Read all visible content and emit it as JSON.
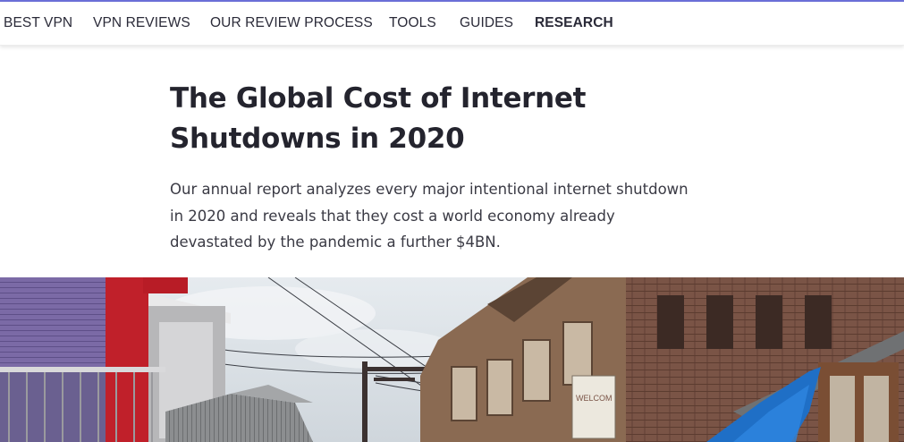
{
  "nav": {
    "items": [
      {
        "label": "BEST VPN",
        "active": false
      },
      {
        "label": "VPN REVIEWS",
        "active": false
      },
      {
        "label": "OUR REVIEW PROCESS",
        "active": false
      },
      {
        "label": "TOOLS",
        "active": false
      },
      {
        "label": "GUIDES",
        "active": false
      },
      {
        "label": "RESEARCH",
        "active": true
      }
    ]
  },
  "article": {
    "title": "The Global Cost of Internet Shutdowns in 2020",
    "summary": "Our annual report analyzes every major intentional internet shutdown in 2020 and reveals that they cost a world economy already devastated by the pandemic a further $4BN."
  },
  "hero": {
    "sign_text": "WELCOM"
  },
  "colors": {
    "accent_line": "#6b6fd8",
    "text_dark": "#24242e"
  }
}
